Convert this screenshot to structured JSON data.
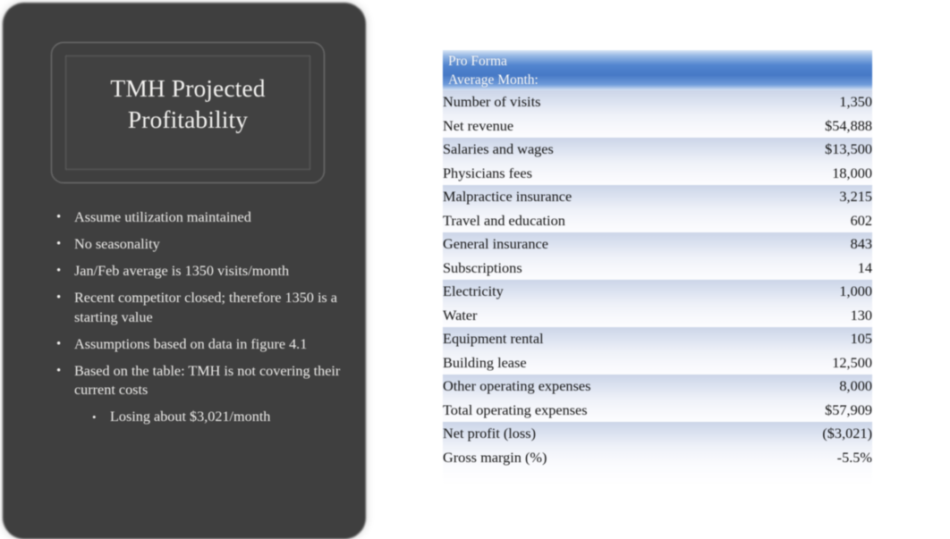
{
  "slide": {
    "background_color": "#ffffff",
    "panel_color": "#3f3f3f",
    "accent_color": "#4679c6"
  },
  "left_panel": {
    "title": "TMH Projected\nProfitability",
    "bullet_marker": "•",
    "sub_bullet_marker": "•",
    "bullets": [
      {
        "level": 1,
        "text": "Assume utilization maintained"
      },
      {
        "level": 1,
        "text": "No seasonality"
      },
      {
        "level": 1,
        "text": "Jan/Feb average is 1350 visits/month"
      },
      {
        "level": 1,
        "text": "Recent competitor closed; therefore 1350 is a starting value"
      },
      {
        "level": 1,
        "text": "Assumptions based on data in figure 4.1"
      },
      {
        "level": 1,
        "text": "Based on the table: TMH is not covering their current costs"
      },
      {
        "level": 2,
        "text": "Losing about $3,021/month"
      }
    ]
  },
  "table": {
    "header": {
      "label": "Pro Forma\nAverage Month:",
      "value_label": ""
    },
    "rows": [
      {
        "label": "Number of visits",
        "value": "1,350",
        "indent": false
      },
      {
        "label": "Net revenue",
        "value": "$54,888",
        "indent": false
      },
      {
        "label": "Salaries and wages",
        "value": "$13,500",
        "indent": false
      },
      {
        "label": "Physicians fees",
        "value": "18,000",
        "indent": false
      },
      {
        "label": "Malpractice insurance",
        "value": "3,215",
        "indent": false
      },
      {
        "label": "Travel and education",
        "value": "602",
        "indent": false
      },
      {
        "label": "General insurance",
        "value": "843",
        "indent": false
      },
      {
        "label": "Subscriptions",
        "value": "14",
        "indent": false
      },
      {
        "label": "Electricity",
        "value": "1,000",
        "indent": false
      },
      {
        "label": "Water",
        "value": "130",
        "indent": false
      },
      {
        "label": "Equipment rental",
        "value": "105",
        "indent": false
      },
      {
        "label": "Building lease",
        "value": "12,500",
        "indent": false
      },
      {
        "label": "Other operating expenses",
        "value": "8,000",
        "indent": false
      },
      {
        "label": "Total operating expenses",
        "value": "$57,909",
        "indent": true
      },
      {
        "label": "Net profit (loss)",
        "value": "($3,021)",
        "indent": false
      },
      {
        "label": "Gross margin (%)",
        "value": "-5.5%",
        "indent": false
      }
    ]
  }
}
